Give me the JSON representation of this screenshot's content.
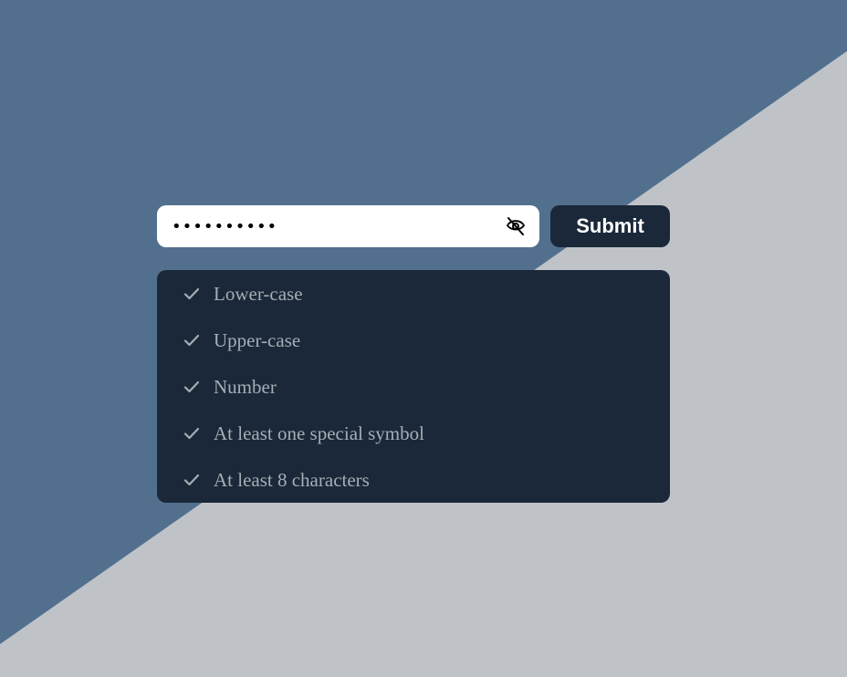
{
  "colors": {
    "background_dark": "#52708e",
    "background_light": "#bfc3c7",
    "panel": "#1a2839",
    "requirement_text": "#a6adb5",
    "check_icon": "#a6adb5",
    "input_background": "#ffffff",
    "button_text": "#ffffff"
  },
  "password": {
    "value": "••••••••••",
    "toggle_icon": "eye-off-icon"
  },
  "submit": {
    "label": "Submit"
  },
  "requirements": [
    {
      "label": "Lower-case",
      "icon": "check-icon"
    },
    {
      "label": "Upper-case",
      "icon": "check-icon"
    },
    {
      "label": "Number",
      "icon": "check-icon"
    },
    {
      "label": "At least one special symbol",
      "icon": "check-icon"
    },
    {
      "label": "At least 8 characters",
      "icon": "check-icon"
    }
  ]
}
